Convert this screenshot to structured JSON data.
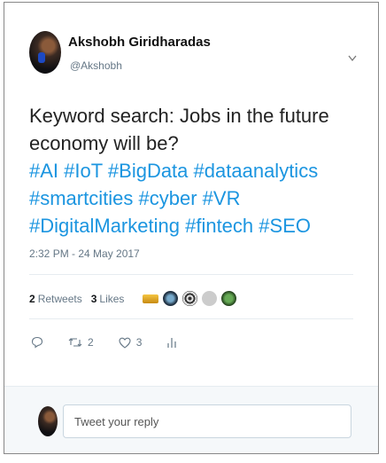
{
  "author": {
    "name": "Akshobh Giridharadas",
    "handle": "@Akshobh"
  },
  "menu_icon": "chevron-down-icon",
  "tweet": {
    "text": "Keyword search: Jobs in the future economy will be?",
    "hashtags": [
      "#AI",
      "#IoT",
      "#BigData",
      "#dataanalytics",
      "#smartcities",
      "#cyber",
      "#VR",
      "#DigitalMarketing",
      "#fintech",
      "#SEO"
    ],
    "timestamp": "2:32 PM - 24 May 2017"
  },
  "stats": {
    "retweets_count": "2",
    "retweets_label": "Retweets",
    "likes_count": "3",
    "likes_label": "Likes",
    "liker_avatars": 5
  },
  "actions": {
    "reply_icon": "reply-icon",
    "retweet_icon": "retweet-icon",
    "retweet_count": "2",
    "like_icon": "heart-icon",
    "like_count": "3",
    "analytics_icon": "analytics-icon"
  },
  "reply": {
    "placeholder": "Tweet your reply"
  },
  "colors": {
    "link": "#1b95e0",
    "muted": "#657786",
    "text": "#14171a"
  }
}
